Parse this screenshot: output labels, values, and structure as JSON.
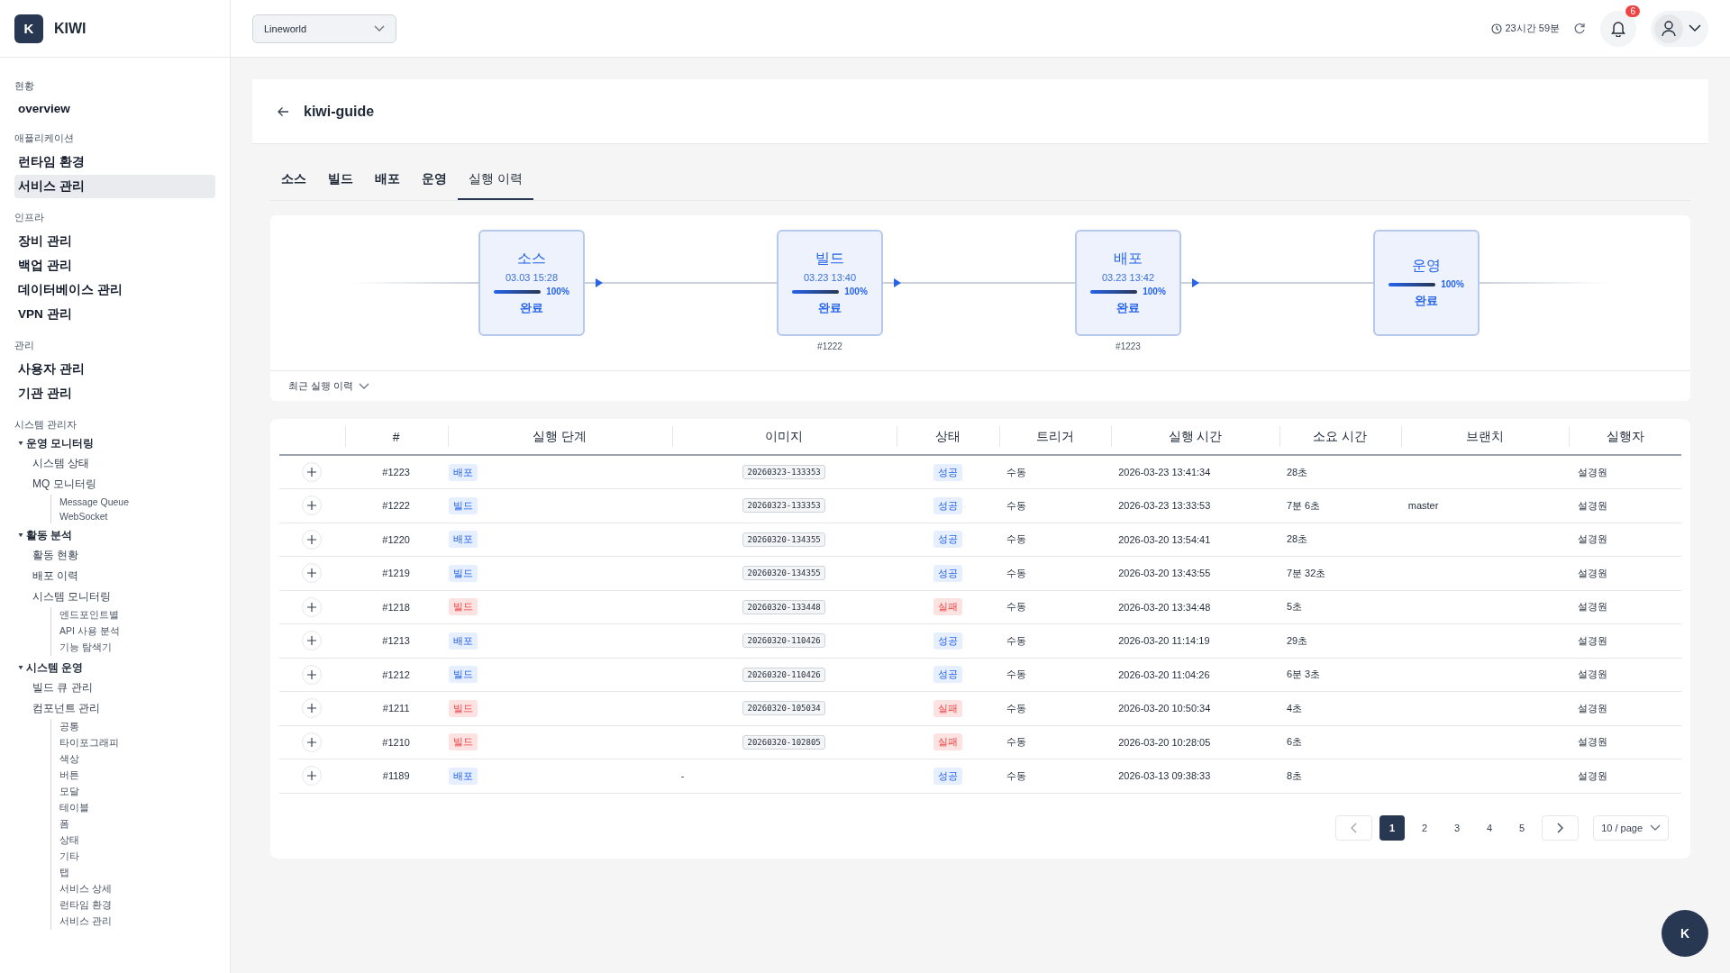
{
  "sidebar": {
    "logo": "K",
    "brand": "KIWI",
    "sections": [
      {
        "title": "현황",
        "items": [
          {
            "label": "overview",
            "selected": false
          }
        ]
      },
      {
        "title": "애플리케이션",
        "items": [
          {
            "label": "런타임 환경",
            "selected": false
          },
          {
            "label": "서비스 관리",
            "selected": true
          }
        ]
      },
      {
        "title": "인프라",
        "items": [
          {
            "label": "장비 관리",
            "selected": false
          },
          {
            "label": "백업 관리",
            "selected": false
          },
          {
            "label": "데이터베이스 관리",
            "selected": false
          },
          {
            "label": "VPN 관리",
            "selected": false
          }
        ]
      },
      {
        "title": "관리",
        "items": [
          {
            "label": "사용자 관리",
            "selected": false
          },
          {
            "label": "기관 관리",
            "selected": false
          }
        ]
      }
    ],
    "admin": {
      "title": "시스템 관리자",
      "groups": [
        {
          "label": "운영 모니터링",
          "expanded": true,
          "children": [
            {
              "label": "시스템 상태"
            },
            {
              "label": "MQ 모니터링",
              "children": [
                {
                  "label": "Message Queue"
                },
                {
                  "label": "WebSocket"
                }
              ]
            }
          ]
        },
        {
          "label": "활동 분석",
          "expanded": true,
          "children": [
            {
              "label": "활동 현황"
            },
            {
              "label": "배포 이력"
            },
            {
              "label": "시스템 모니터링",
              "children": [
                {
                  "label": "엔드포인트별"
                },
                {
                  "label": "API 사용 분석"
                },
                {
                  "label": "기능 탐색기"
                }
              ]
            }
          ]
        },
        {
          "label": "시스템 운영",
          "expanded": true,
          "children": [
            {
              "label": "빌드 큐 관리"
            },
            {
              "label": "컴포넌트 관리",
              "children": [
                {
                  "label": "공통"
                },
                {
                  "label": "타이포그래피"
                },
                {
                  "label": "색상"
                },
                {
                  "label": "버튼"
                },
                {
                  "label": "모달"
                },
                {
                  "label": "테이블"
                },
                {
                  "label": "폼"
                },
                {
                  "label": "상태"
                },
                {
                  "label": "기타"
                },
                {
                  "label": "탭"
                },
                {
                  "label": "서비스 상세"
                },
                {
                  "label": "런타임 환경"
                },
                {
                  "label": "서비스 관리"
                }
              ]
            }
          ]
        }
      ]
    }
  },
  "topbar": {
    "workspace": "Lineworld",
    "session": "23시간 59분",
    "notifications": "6"
  },
  "page": {
    "title": "kiwi-guide"
  },
  "tabs": [
    {
      "label": "소스",
      "selected": false
    },
    {
      "label": "빌드",
      "selected": false
    },
    {
      "label": "배포",
      "selected": false
    },
    {
      "label": "운영",
      "selected": false
    },
    {
      "label": "실행 이력",
      "selected": true
    }
  ],
  "pipeline": {
    "stages": [
      {
        "name": "소스",
        "time": "03.03 15:28",
        "level": 1,
        "percent": "100%",
        "status": "완료"
      },
      {
        "name": "빌드",
        "time": "03.23 13:40",
        "level": 1,
        "percent": "100%",
        "status": "완료",
        "run": "#1222"
      },
      {
        "name": "배포",
        "time": "03.23 13:42",
        "level": 1,
        "percent": "100%",
        "status": "완료",
        "run": "#1223"
      },
      {
        "name": "운영",
        "level": 1,
        "percent": "100%",
        "status": "완료"
      }
    ],
    "recent_toggle": "최근 실행 이력"
  },
  "table": {
    "columns": [
      "#",
      "실행 단계",
      "이미지",
      "상태",
      "트리거",
      "실행 시간",
      "소요 시간",
      "브랜치",
      "실행자"
    ],
    "rows": [
      {
        "id": "#1223",
        "stage": "배포",
        "image": "20260323-133353",
        "status": "성공",
        "failed": false,
        "trigger": "수동",
        "time": "2026-03-23 13:41:34",
        "duration": "28초",
        "executor": "설경원"
      },
      {
        "id": "#1222",
        "stage": "빌드",
        "image": "20260323-133353",
        "status": "성공",
        "failed": false,
        "trigger": "수동",
        "time": "2026-03-23 13:33:53",
        "duration": "7분 6초",
        "branch": "master",
        "executor": "설경원"
      },
      {
        "id": "#1220",
        "stage": "배포",
        "image": "20260320-134355",
        "status": "성공",
        "failed": false,
        "trigger": "수동",
        "time": "2026-03-20 13:54:41",
        "duration": "28초",
        "executor": "설경원"
      },
      {
        "id": "#1219",
        "stage": "빌드",
        "image": "20260320-134355",
        "status": "성공",
        "failed": false,
        "trigger": "수동",
        "time": "2026-03-20 13:43:55",
        "duration": "7분 32초",
        "executor": "설경원"
      },
      {
        "id": "#1218",
        "stage": "빌드",
        "image": "20260320-133448",
        "status": "실패",
        "failed": true,
        "trigger": "수동",
        "time": "2026-03-20 13:34:48",
        "duration": "5초",
        "executor": "설경원"
      },
      {
        "id": "#1213",
        "stage": "배포",
        "image": "20260320-110426",
        "status": "성공",
        "failed": false,
        "trigger": "수동",
        "time": "2026-03-20 11:14:19",
        "duration": "29초",
        "executor": "설경원"
      },
      {
        "id": "#1212",
        "stage": "빌드",
        "image": "20260320-110426",
        "status": "성공",
        "failed": false,
        "trigger": "수동",
        "time": "2026-03-20 11:04:26",
        "duration": "6분 3초",
        "executor": "설경원"
      },
      {
        "id": "#1211",
        "stage": "빌드",
        "image": "20260320-105034",
        "status": "실패",
        "failed": true,
        "trigger": "수동",
        "time": "2026-03-20 10:50:34",
        "duration": "4초",
        "executor": "설경원"
      },
      {
        "id": "#1210",
        "stage": "빌드",
        "image": "20260320-102805",
        "status": "실패",
        "failed": true,
        "trigger": "수동",
        "time": "2026-03-20 10:28:05",
        "duration": "6초",
        "executor": "설경원"
      },
      {
        "id": "#1189",
        "stage": "배포",
        "image_text": "-",
        "status": "성공",
        "failed": false,
        "trigger": "수동",
        "time": "2026-03-13 09:38:33",
        "duration": "8초",
        "executor": "설경원"
      }
    ]
  },
  "pagination": {
    "pages": [
      {
        "label": "1",
        "selected": true
      },
      {
        "label": "2",
        "selected": false
      },
      {
        "label": "3",
        "selected": false
      },
      {
        "label": "4",
        "selected": false
      },
      {
        "label": "5",
        "selected": false
      }
    ],
    "page_size": "10 / page"
  },
  "fab": "K"
}
